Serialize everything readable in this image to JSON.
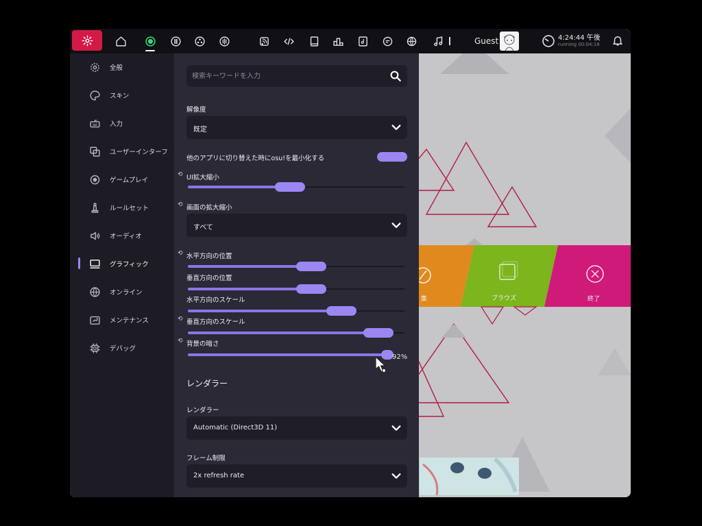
{
  "topbar": {
    "user_name": "Guest",
    "time": "4:24:44 午後",
    "running": "running 00:04:18",
    "icons": [
      "settings-icon",
      "home-icon",
      "ruleset-osu-icon",
      "ruleset-taiko-icon",
      "ruleset-catch-icon",
      "ruleset-mania-icon",
      "news-icon",
      "changelog-icon",
      "wiki-icon",
      "rankings-icon",
      "beatmap-listing-icon",
      "chat-icon",
      "dashboard-icon",
      "now-playing-icon",
      "notification-icon"
    ]
  },
  "sidebar": {
    "items": [
      {
        "label": "全般",
        "icon": "gear-icon"
      },
      {
        "label": "スキン",
        "icon": "palette-icon"
      },
      {
        "label": "入力",
        "icon": "keyboard-icon"
      },
      {
        "label": "ユーザーインターフ",
        "icon": "window-icon"
      },
      {
        "label": "ゲームプレイ",
        "icon": "gameplay-icon"
      },
      {
        "label": "ルールセット",
        "icon": "chess-icon"
      },
      {
        "label": "オーディオ",
        "icon": "speaker-icon"
      },
      {
        "label": "グラフィック",
        "icon": "monitor-icon"
      },
      {
        "label": "オンライン",
        "icon": "globe-icon"
      },
      {
        "label": "メンテナンス",
        "icon": "wrench-icon"
      },
      {
        "label": "デバッグ",
        "icon": "chip-icon"
      }
    ],
    "active": "グラフィック"
  },
  "panel": {
    "search_placeholder": "検索キーワードを入力",
    "resolution_label": "解像度",
    "resolution_value": "既定",
    "minimize_label": "他のアプリに切り替えた時にosu!を最小化する",
    "minimize_on": true,
    "ui_scale_label": "UI拡大縮小",
    "ui_scale": 0.47,
    "screen_scale_label": "画面の拡大縮小",
    "screen_scale_value": "すべて",
    "h_pos_label": "水平方向の位置",
    "h_pos": 0.57,
    "v_pos_label": "垂直方向の位置",
    "v_pos": 0.57,
    "h_scale_label": "水平方向のスケール",
    "h_scale": 0.71,
    "v_scale_label": "垂直方向のスケール",
    "v_scale": 0.88,
    "dim_label": "背景の暗さ",
    "dim": 0.92,
    "dim_text": "92%",
    "section_title": "レンダラー",
    "renderer_label": "レンダラー",
    "renderer_value": "Automatic (Direct3D 11)",
    "frame_label": "フレーム制限",
    "frame_value": "2x refresh rate"
  },
  "menu": {
    "browse_label": "ブラウズ",
    "exit_label": "終了",
    "play_label_fragment": "集"
  },
  "colors": {
    "accent": "#9b86f2",
    "settings_button": "#d31a47",
    "menu_orange": "#e08a1e",
    "menu_green": "#7cb51c",
    "menu_pink": "#d01a7a"
  }
}
